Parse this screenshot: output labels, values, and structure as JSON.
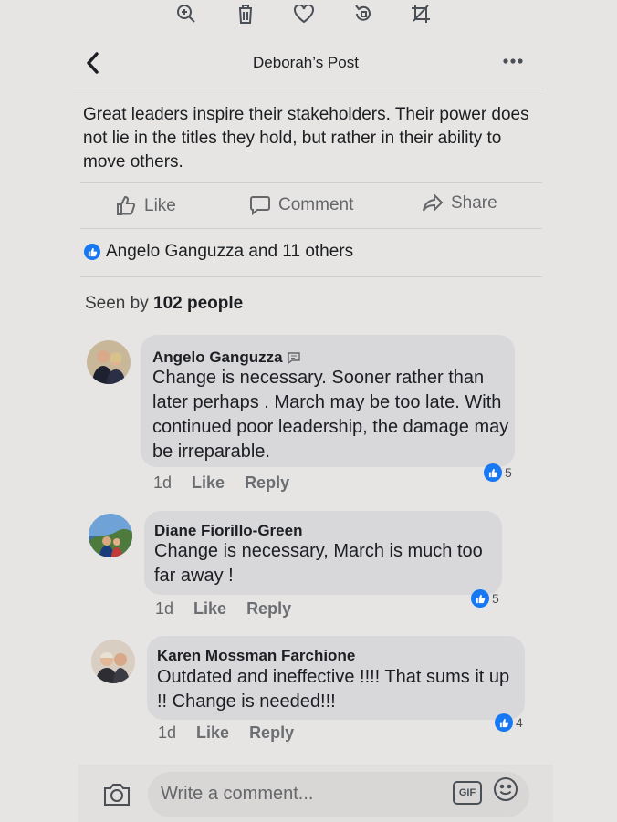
{
  "toolbar": {
    "icons": [
      "zoom-icon",
      "trash-icon",
      "heart-icon",
      "rotate-icon",
      "crop-icon"
    ]
  },
  "header": {
    "title": "Deborah’s Post",
    "back_icon": "chevron-left-icon",
    "more_icon": "more-dots-icon"
  },
  "post": {
    "text": "Great leaders inspire their stakeholders.  Their power does not lie in the titles they hold, but rather in their ability to move others."
  },
  "actions": {
    "like": "Like",
    "comment": "Comment",
    "share": "Share"
  },
  "reactions": {
    "summary": "Angelo Ganguzza and 11 others"
  },
  "seen": {
    "prefix": "Seen by",
    "count": "102 people"
  },
  "comments": [
    {
      "name": "Angelo Ganguzza",
      "text": "Change is necessary. Sooner rather than later perhaps . March may be too late. With continued poor leadership, the damage may be irreparable.",
      "time": "1d",
      "like": "Like",
      "reply": "Reply",
      "reactions": "5"
    },
    {
      "name": "Diane Fiorillo-Green",
      "text": "Change is necessary, March is much too far away !",
      "time": "1d",
      "like": "Like",
      "reply": "Reply",
      "reactions": "5"
    },
    {
      "name": "Karen Mossman Farchione",
      "text": "Outdated and ineffective !!!! That sums it up !! Change is needed!!!",
      "time": "1d",
      "like": "Like",
      "reply": "Reply",
      "reactions": "4"
    }
  ],
  "composer": {
    "placeholder": "Write a comment...",
    "gif": "GIF"
  },
  "colors": {
    "accent": "#1877f2",
    "bubble": "#d8d8db",
    "background": "#e6e5e3"
  }
}
